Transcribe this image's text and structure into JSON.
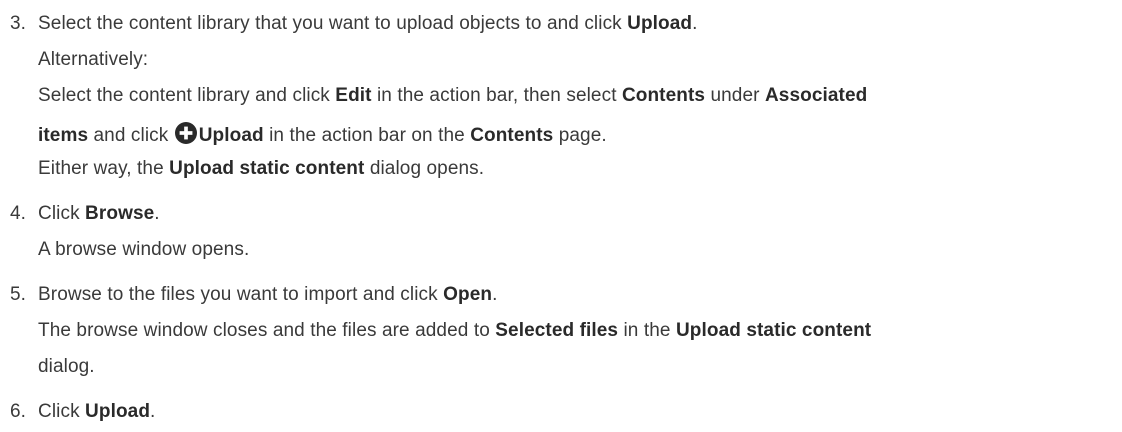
{
  "steps": [
    {
      "number": "3.",
      "l1_a": "Select the content library that you want to upload objects to and click ",
      "l1_b": "Upload",
      "l1_c": ".",
      "l2": "Alternatively:",
      "l3_a": "Select the content library and click ",
      "l3_b": "Edit",
      "l3_c": " in the action bar, then select ",
      "l3_d": "Contents",
      "l3_e": " under ",
      "l3_f": "Associated",
      "l4_a": "items",
      "l4_b": " and click ",
      "l4_icon": "plus-circle-icon",
      "l4_c": "Upload",
      "l4_d": " in the action bar on the ",
      "l4_e": "Contents",
      "l4_f": " page.",
      "l5_a": "Either way, the ",
      "l5_b": "Upload static content",
      "l5_c": " dialog opens."
    },
    {
      "number": "4.",
      "l1_a": "Click ",
      "l1_b": "Browse",
      "l1_c": ".",
      "l2": "A browse window opens."
    },
    {
      "number": "5.",
      "l1_a": "Browse to the files you want to import and click ",
      "l1_b": "Open",
      "l1_c": ".",
      "l2_a": "The browse window closes and the files are added to ",
      "l2_b": "Selected files",
      "l2_c": " in the ",
      "l2_d": "Upload static content",
      "l3": "dialog."
    },
    {
      "number": "6.",
      "l1_a": "Click ",
      "l1_b": "Upload",
      "l1_c": "."
    }
  ],
  "colors": {
    "text": "#3a3a3a",
    "icon": "#2a2a2a"
  }
}
